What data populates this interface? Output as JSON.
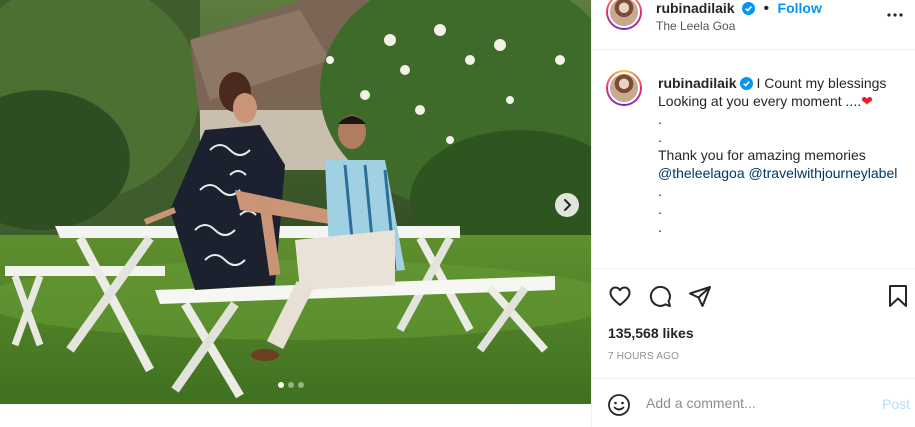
{
  "post": {
    "username": "rubinadilaik",
    "follow_label": "Follow",
    "separator": "•",
    "location": "The Leela Goa",
    "more_icon": "more-horizontal-icon"
  },
  "caption": {
    "line1": "I Count my blessings",
    "line2": "Looking at you every moment ....",
    "heart": "❤",
    "dot": ".",
    "line3": "Thank you for amazing memories",
    "mention1": "@theleelagoa",
    "mention2": "@travelwithjourneylabel"
  },
  "actions": {
    "likes": "135,568 likes",
    "time": "7 HOURS AGO",
    "icons": [
      "heart-icon",
      "comment-icon",
      "share-icon",
      "bookmark-icon"
    ]
  },
  "comment": {
    "placeholder": "Add a comment...",
    "post_label": "Post"
  },
  "carousel": {
    "slide_count": 3,
    "active_slide": 1
  },
  "colors": {
    "link": "#0095f6",
    "mention": "#00376b",
    "heart": "#ed1c24",
    "post_disabled": "#b2dffc"
  }
}
